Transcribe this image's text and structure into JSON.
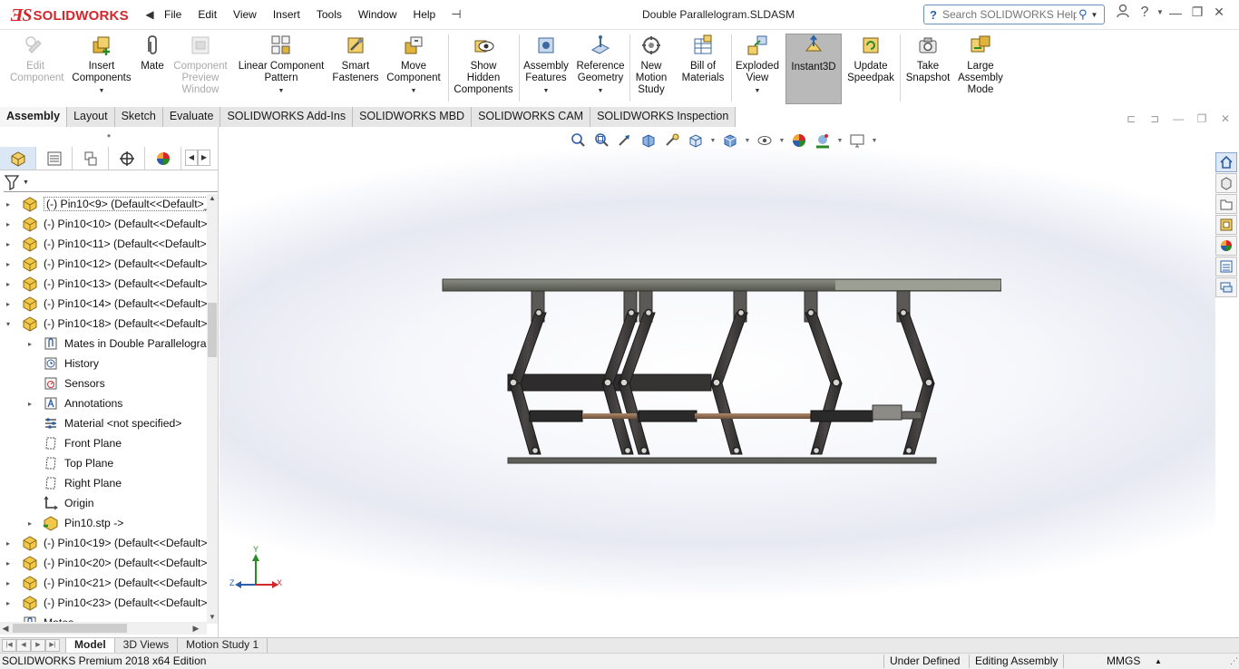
{
  "app": {
    "brand": "SOLIDWORKS",
    "document_title": "Double Parallelogram.SLDASM"
  },
  "menu": {
    "items": [
      "File",
      "Edit",
      "View",
      "Insert",
      "Tools",
      "Window",
      "Help"
    ]
  },
  "search": {
    "placeholder": "Search SOLIDWORKS Help"
  },
  "ribbon": {
    "edit_component": "Edit Component",
    "insert_components": "Insert Components",
    "mate": "Mate",
    "component_preview": "Component Preview Window",
    "linear_pattern": "Linear Component Pattern",
    "smart_fasteners": "Smart Fasteners",
    "move_component": "Move Component",
    "show_hidden": "Show Hidden Components",
    "assembly_features": "Assembly Features",
    "reference_geometry": "Reference Geometry",
    "new_motion_study": "New Motion Study",
    "bill_of_materials": "Bill of Materials",
    "exploded_view": "Exploded View",
    "instant3d": "Instant3D",
    "update_speedpak": "Update Speedpak",
    "take_snapshot": "Take Snapshot",
    "large_assembly_mode": "Large Assembly Mode"
  },
  "cmd_tabs": [
    "Assembly",
    "Layout",
    "Sketch",
    "Evaluate",
    "SOLIDWORKS Add-Ins",
    "SOLIDWORKS MBD",
    "SOLIDWORKS CAM",
    "SOLIDWORKS Inspection"
  ],
  "tree": {
    "rows": [
      {
        "label": "(-) Pin10<9> (Default<<Default>_",
        "kind": "part",
        "expander": "▸",
        "selected": true
      },
      {
        "label": "(-) Pin10<10> (Default<<Default>",
        "kind": "part",
        "expander": "▸"
      },
      {
        "label": "(-) Pin10<11> (Default<<Default>",
        "kind": "part",
        "expander": "▸"
      },
      {
        "label": "(-) Pin10<12> (Default<<Default>",
        "kind": "part",
        "expander": "▸"
      },
      {
        "label": "(-) Pin10<13> (Default<<Default>",
        "kind": "part",
        "expander": "▸"
      },
      {
        "label": "(-) Pin10<14> (Default<<Default>",
        "kind": "part",
        "expander": "▸"
      },
      {
        "label": "(-) Pin10<18> (Default<<Default>",
        "kind": "part",
        "expander": "▾"
      },
      {
        "label": "Mates in Double Parallelogra",
        "kind": "mates",
        "expander": "▸",
        "child": true
      },
      {
        "label": "History",
        "kind": "history",
        "expander": "",
        "child": true
      },
      {
        "label": "Sensors",
        "kind": "sensors",
        "expander": "",
        "child": true
      },
      {
        "label": "Annotations",
        "kind": "annotations",
        "expander": "▸",
        "child": true
      },
      {
        "label": "Material <not specified>",
        "kind": "material",
        "expander": "",
        "child": true
      },
      {
        "label": "Front Plane",
        "kind": "plane",
        "expander": "",
        "child": true
      },
      {
        "label": "Top Plane",
        "kind": "plane",
        "expander": "",
        "child": true
      },
      {
        "label": "Right Plane",
        "kind": "plane",
        "expander": "",
        "child": true
      },
      {
        "label": "Origin",
        "kind": "origin",
        "expander": "",
        "child": true
      },
      {
        "label": "Pin10.stp ->",
        "kind": "feature",
        "expander": "▸",
        "child": true
      },
      {
        "label": "(-) Pin10<19> (Default<<Default>",
        "kind": "part",
        "expander": "▸"
      },
      {
        "label": "(-) Pin10<20> (Default<<Default>",
        "kind": "part",
        "expander": "▸"
      },
      {
        "label": "(-) Pin10<21> (Default<<Default>",
        "kind": "part",
        "expander": "▸"
      },
      {
        "label": "(-) Pin10<23> (Default<<Default>",
        "kind": "part",
        "expander": "▸"
      },
      {
        "label": "Mates",
        "kind": "mates",
        "expander": "▸"
      }
    ]
  },
  "triad": {
    "x": "X",
    "y": "Y",
    "z": "Z"
  },
  "bottom_tabs": [
    "Model",
    "3D Views",
    "Motion Study 1"
  ],
  "status": {
    "edition": "SOLIDWORKS Premium 2018 x64 Edition",
    "definition": "Under Defined",
    "mode": "Editing Assembly",
    "units": "MMGS"
  },
  "colors": {
    "brand_red": "#d4262b",
    "frame_dark": "#3b3838",
    "top_plate": "#6b6d63",
    "rod_copper": "#8a6a52"
  }
}
